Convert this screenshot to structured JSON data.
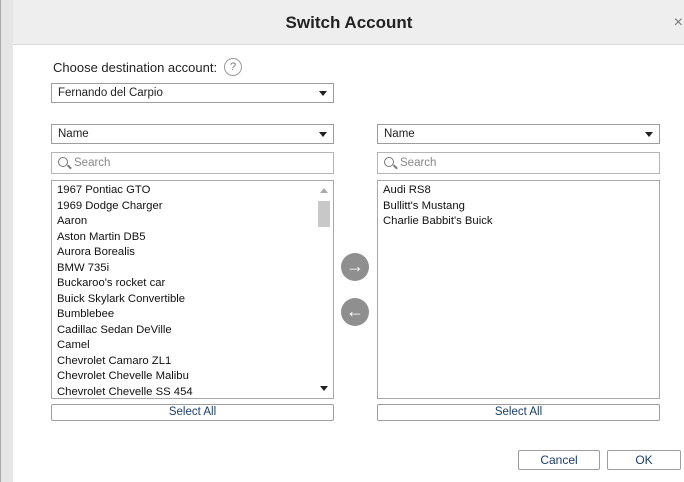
{
  "dialog": {
    "title": "Switch Account",
    "close_symbol": "×"
  },
  "destination": {
    "label": "Choose destination account:",
    "help_symbol": "?",
    "selected": "Fernando del Carpio"
  },
  "left_panel": {
    "sort_by": "Name",
    "search_placeholder": "Search",
    "items": [
      "1967 Pontiac GTO",
      "1969 Dodge Charger",
      "Aaron",
      "Aston Martin DB5",
      "Aurora Borealis",
      "BMW 735i",
      "Buckaroo's rocket car",
      "Buick Skylark Convertible",
      "Bumblebee",
      "Cadillac Sedan DeVille",
      "Camel",
      "Chevrolet Camaro ZL1",
      "Chevrolet Chevelle Malibu",
      "Chevrolet Chevelle SS 454"
    ],
    "select_all_label": "Select All"
  },
  "right_panel": {
    "sort_by": "Name",
    "search_placeholder": "Search",
    "items": [
      "Audi RS8",
      "Bullitt's Mustang",
      "Charlie Babbit's Buick"
    ],
    "select_all_label": "Select All"
  },
  "transfer": {
    "move_right_symbol": "→",
    "move_left_symbol": "←"
  },
  "footer": {
    "cancel_label": "Cancel",
    "ok_label": "OK"
  }
}
